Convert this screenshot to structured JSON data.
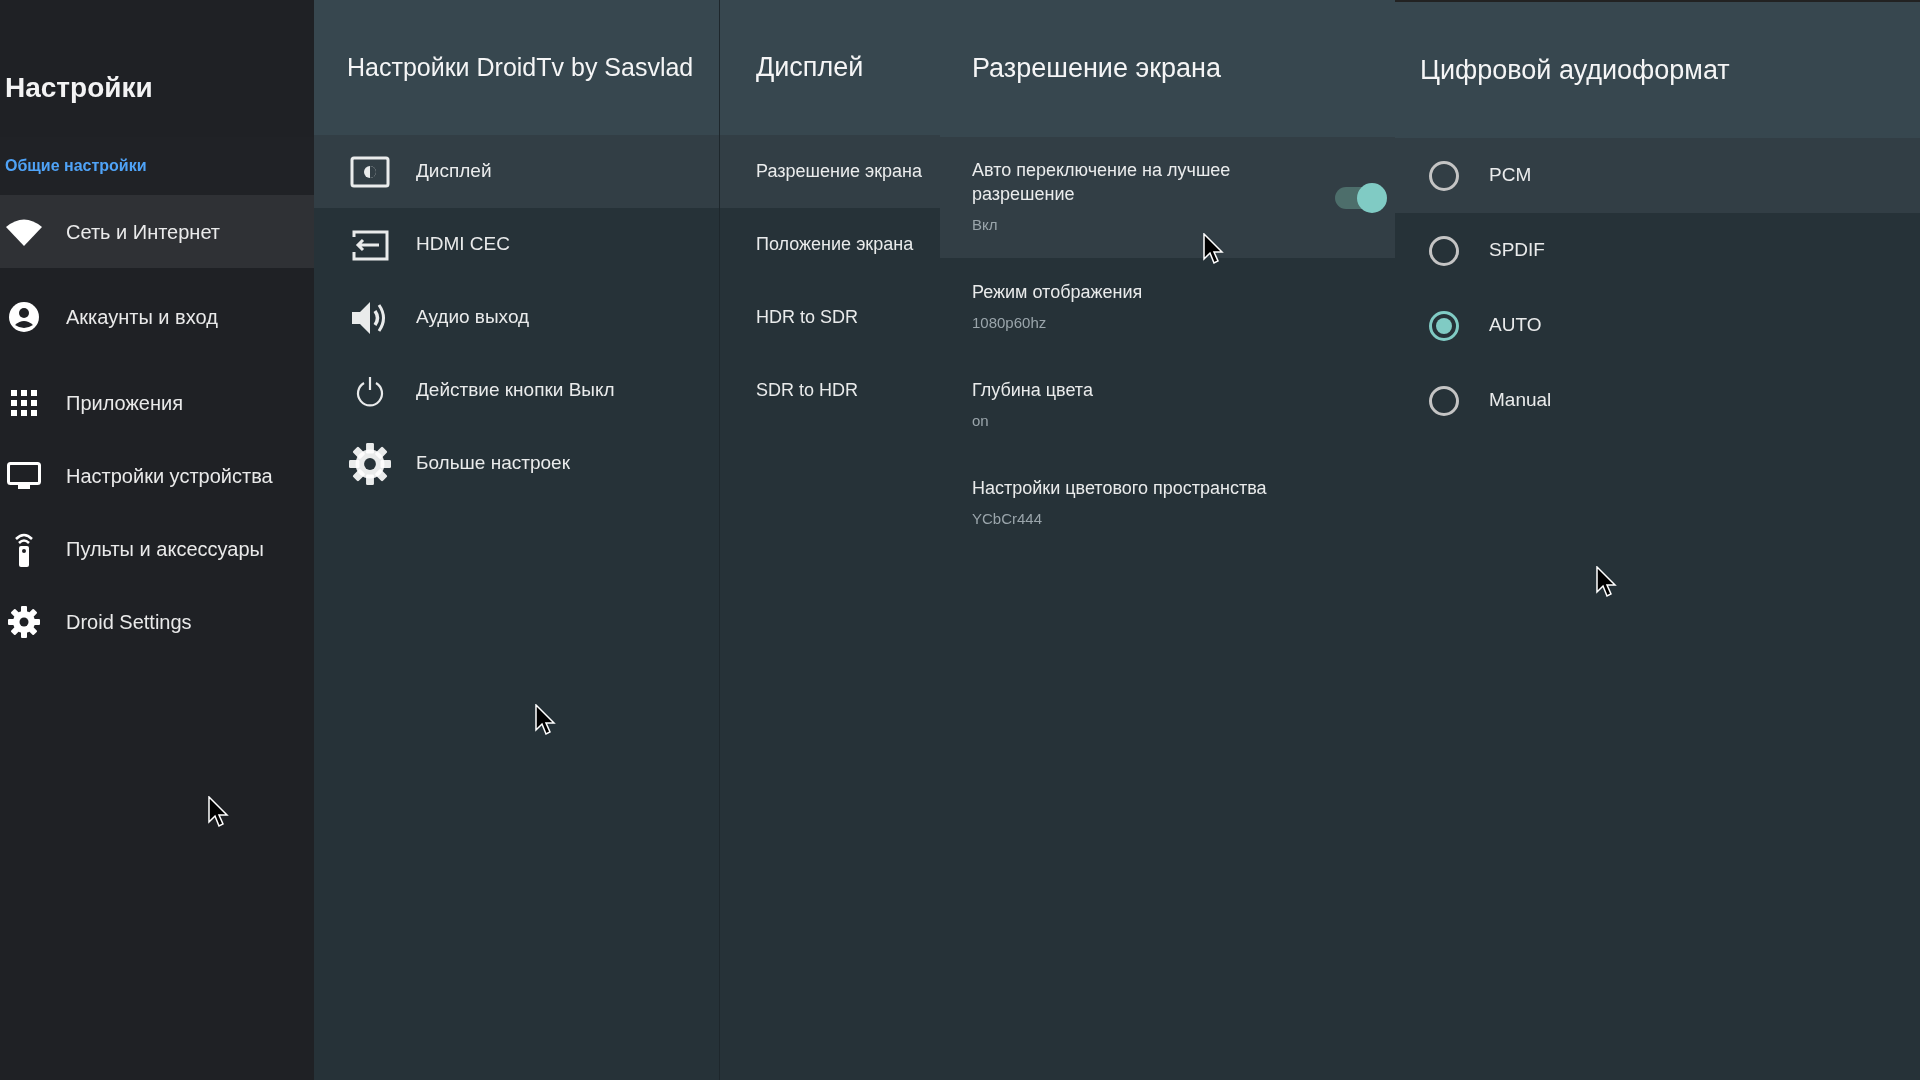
{
  "main_menu": {
    "title": "Настройки",
    "section_label": "Общие настройки",
    "items": [
      {
        "label": "Сеть и Интернет",
        "selected": true
      },
      {
        "label": "Аккаунты и вход",
        "selected": false
      },
      {
        "label": "Приложения",
        "selected": false
      },
      {
        "label": "Настройки устройства",
        "selected": false
      },
      {
        "label": "Пульты и аксессуары",
        "selected": false
      },
      {
        "label": "Droid Settings",
        "selected": false
      }
    ]
  },
  "droid_menu": {
    "title": "Настройки DroidTv by Sasvlad",
    "items": [
      {
        "label": "Дисплей",
        "selected": true
      },
      {
        "label": "HDMI CEC",
        "selected": false
      },
      {
        "label": "Аудио выход",
        "selected": false
      },
      {
        "label": "Действие кнопки Выкл",
        "selected": false
      },
      {
        "label": "Больше настроек",
        "selected": false
      }
    ]
  },
  "display_menu": {
    "title": "Дисплей",
    "items": [
      {
        "label": "Разрешение экрана",
        "selected": true
      },
      {
        "label": "Положение экрана",
        "selected": false
      },
      {
        "label": "HDR to SDR",
        "selected": false
      },
      {
        "label": "SDR to HDR",
        "selected": false
      }
    ]
  },
  "resolution_menu": {
    "title": "Разрешение экрана",
    "items": [
      {
        "kind": "switch",
        "title": "Авто переключение на лучшее разрешение",
        "summary": "Вкл",
        "on": true,
        "selected": true
      },
      {
        "kind": "info",
        "title": "Режим отображения",
        "summary": "1080p60hz",
        "selected": false
      },
      {
        "kind": "info",
        "title": "Глубина цвета",
        "summary": "on",
        "selected": false
      },
      {
        "kind": "info",
        "title": "Настройки цветового пространства",
        "summary": "YCbCr444",
        "selected": false
      }
    ]
  },
  "audio_format": {
    "title": "Цифровой аудиоформат",
    "options": [
      {
        "label": "PCM",
        "selected": false,
        "focused": true
      },
      {
        "label": "SPDIF",
        "selected": false,
        "focused": false
      },
      {
        "label": "AUTO",
        "selected": true,
        "focused": false
      },
      {
        "label": "Manual",
        "selected": false,
        "focused": false
      }
    ]
  }
}
